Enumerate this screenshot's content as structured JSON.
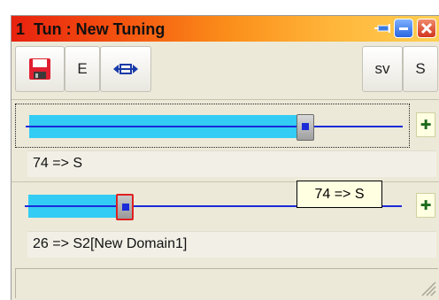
{
  "window": {
    "title": "1  Tun : New Tuning",
    "accent_start": "#e8220f",
    "accent_end": "#ffcf54"
  },
  "titlebar_buttons": [
    {
      "name": "pin",
      "icon": "pin-icon"
    },
    {
      "name": "minimize",
      "icon": "minimize-icon"
    },
    {
      "name": "close",
      "icon": "close-icon"
    }
  ],
  "toolbar": {
    "save_icon": "floppy-disk-icon",
    "e_label": "E",
    "fit_icon": "fit-width-icon",
    "sv_label": "sv",
    "s_label": "S"
  },
  "sliders": [
    {
      "label": "74 => S",
      "value": 74,
      "max": 100,
      "plus_icon": "add-icon"
    },
    {
      "label": "26 => S2[New Domain1]",
      "value": 26,
      "max": 100,
      "plus_icon": "add-icon"
    }
  ],
  "tooltip": {
    "text": "74 => S"
  },
  "colors": {
    "fill": "#33ccf4",
    "line": "#1a2bd8",
    "thumb_active": "#e02020"
  }
}
